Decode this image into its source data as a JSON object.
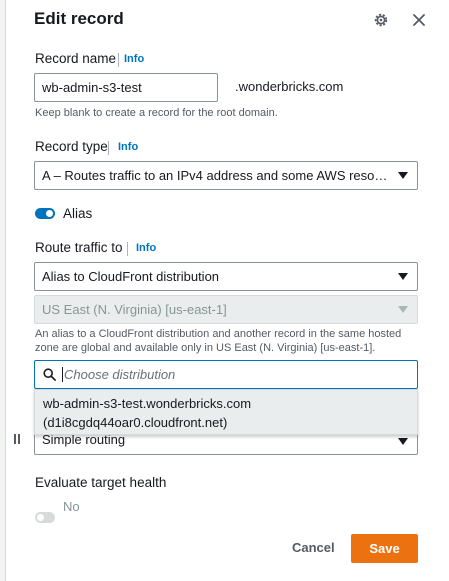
{
  "dialog": {
    "title": "Edit record"
  },
  "record_name": {
    "label": "Record name",
    "info": "Info",
    "value": "wb-admin-s3-test",
    "suffix": ".wonderbricks.com",
    "hint": "Keep blank to create a record for the root domain."
  },
  "record_type": {
    "label": "Record type",
    "info": "Info",
    "value": "A – Routes traffic to an IPv4 address and some AWS resou…"
  },
  "alias": {
    "label": "Alias",
    "enabled": true
  },
  "route_traffic": {
    "label": "Route traffic to",
    "info": "Info",
    "target": "Alias to CloudFront distribution",
    "region": "US East (N. Virginia) [us-east-1]",
    "hint": "An alias to a CloudFront distribution and another record in the same hosted zone are global and available only in US East (N. Virginia) [us-east-1].",
    "search_placeholder": "Choose distribution",
    "options": [
      {
        "line1": "wb-admin-s3-test.wonderbricks.com",
        "line2": "(d1i8cgdq44oar0.cloudfront.net)"
      }
    ]
  },
  "routing_policy": {
    "value": "Simple routing"
  },
  "evaluate_health": {
    "label": "Evaluate target health",
    "value": "No",
    "enabled": false
  },
  "footer": {
    "cancel": "Cancel",
    "save": "Save"
  },
  "colors": {
    "accent": "#0073bb",
    "primary_button": "#ec7211"
  }
}
